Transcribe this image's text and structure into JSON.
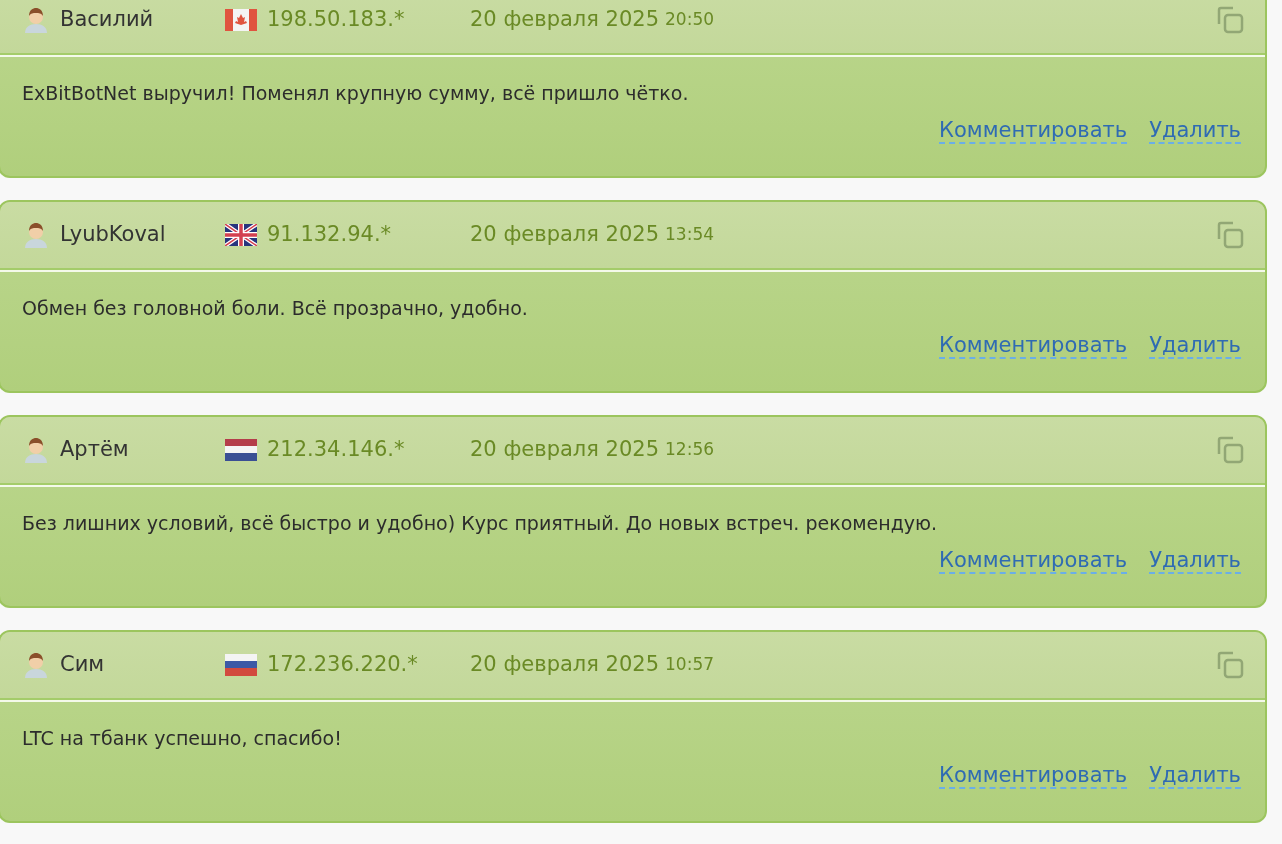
{
  "reviews": [
    {
      "author": "Василий",
      "kind": "canada",
      "ip": "198.50.183.*",
      "date": "20 февраля 2025",
      "time": "20:50",
      "text": "ExBitBotNet выручил! Поменял крупную сумму, всё пришло чётко.",
      "actions": [
        "Комментировать",
        "Удалить"
      ]
    },
    {
      "author": "LyubKoval",
      "kind": "uk",
      "ip": "91.132.94.*",
      "date": "20 февраля 2025",
      "time": "13:54",
      "text": "Обмен без головной боли. Всё прозрачно, удобно.",
      "actions": [
        "Комментировать",
        "Удалить"
      ]
    },
    {
      "author": "Артём",
      "kind": "netherlands",
      "ip": "212.34.146.*",
      "date": "20 февраля 2025",
      "time": "12:56",
      "text": "Без лишних условий, всё быстро и удобно) Курс приятный. До новых встреч. рекомендую.",
      "actions": [
        "Комментировать",
        "Удалить"
      ]
    },
    {
      "author": "Сим",
      "kind": "russia",
      "ip": "172.236.220.*",
      "date": "20 февраля 2025",
      "time": "10:57",
      "text": "LTC на тбанк успешно, спасибо!",
      "actions": [
        "Комментировать",
        "Удалить"
      ]
    }
  ]
}
